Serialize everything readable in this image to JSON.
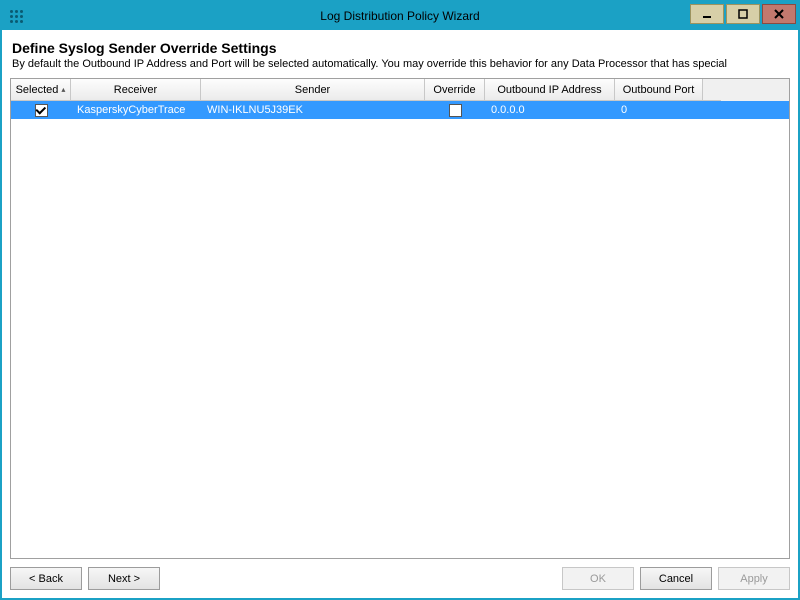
{
  "window": {
    "title": "Log Distribution Policy Wizard"
  },
  "page": {
    "heading": "Define Syslog Sender Override Settings",
    "subtext": "By default the Outbound IP Address and Port will be selected automatically.  You may override this behavior for any Data Processor that has special"
  },
  "grid": {
    "columns": {
      "selected": "Selected",
      "receiver": "Receiver",
      "sender": "Sender",
      "override": "Override",
      "ip": "Outbound IP Address",
      "port": "Outbound Port"
    },
    "rows": [
      {
        "selected": true,
        "receiver": "KasperskyCyberTrace",
        "sender": "WIN-IKLNU5J39EK",
        "override": false,
        "ip": "0.0.0.0",
        "port": "0"
      }
    ]
  },
  "buttons": {
    "back": "< Back",
    "next": "Next >",
    "ok": "OK",
    "cancel": "Cancel",
    "apply": "Apply"
  }
}
